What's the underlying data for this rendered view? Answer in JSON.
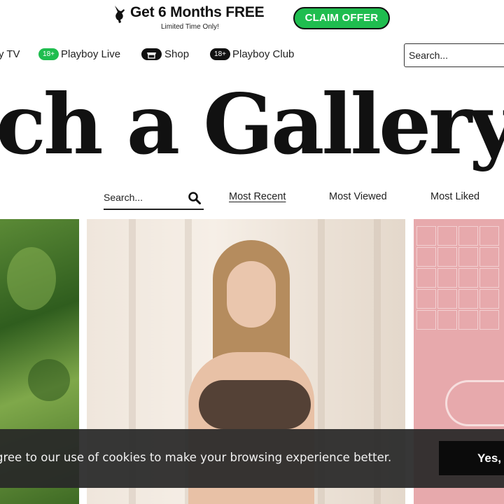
{
  "promo": {
    "title": "Get 6 Months FREE",
    "subtitle": "Limited Time Only!",
    "cta": "CLAIM OFFER"
  },
  "nav": {
    "items": [
      {
        "label": "y TV"
      },
      {
        "label": "Playboy Live",
        "badge": "18+"
      },
      {
        "label": "Shop"
      },
      {
        "label": "Playboy Club",
        "badge": "18+"
      }
    ],
    "search_placeholder": "Search..."
  },
  "headline": "ch a Gallery",
  "filters": {
    "search_placeholder": "Search...",
    "sort": [
      "Most Recent",
      "Most Viewed",
      "Most Liked"
    ],
    "active_sort": "Most Recent"
  },
  "cookie": {
    "text": "gree to our use of cookies to make your browsing experience better.",
    "button": "Yes,"
  },
  "colors": {
    "accent_green": "#1fbd4f",
    "dark": "#111111",
    "cookie_bg": "#282828"
  },
  "icons": [
    "playboy-bunny-icon",
    "shop-icon",
    "search-icon"
  ]
}
